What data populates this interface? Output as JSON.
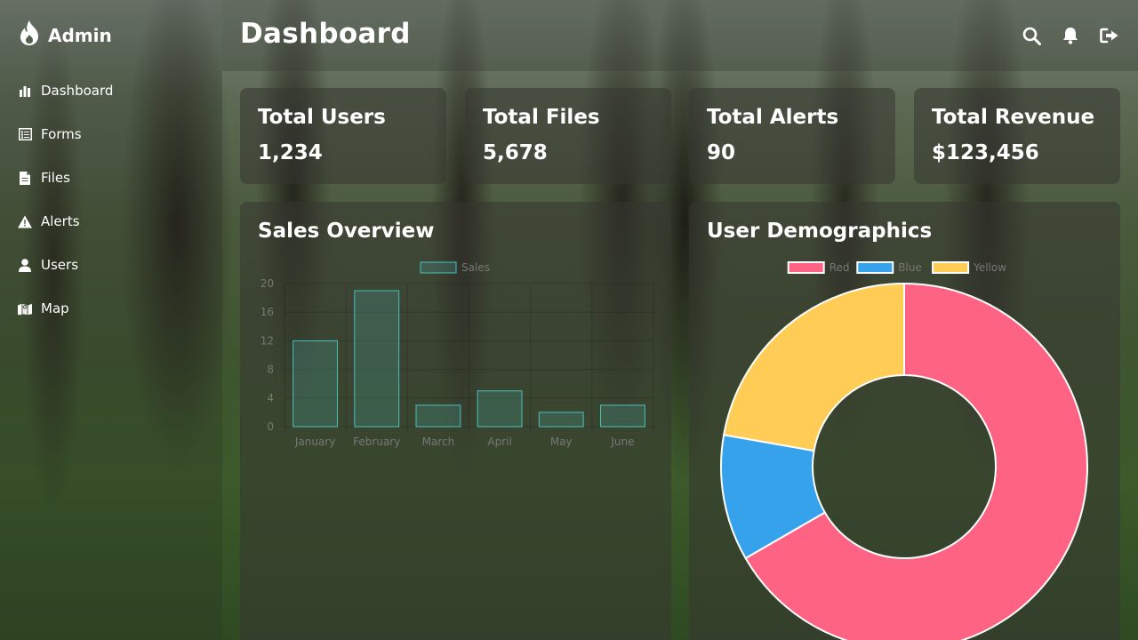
{
  "brand": {
    "name": "Admin",
    "icon": "fire-icon"
  },
  "sidebar": {
    "items": [
      {
        "label": "Dashboard",
        "icon": "bar-chart-icon"
      },
      {
        "label": "Forms",
        "icon": "form-icon"
      },
      {
        "label": "Files",
        "icon": "file-icon"
      },
      {
        "label": "Alerts",
        "icon": "warning-icon"
      },
      {
        "label": "Users",
        "icon": "user-icon"
      },
      {
        "label": "Map",
        "icon": "map-icon"
      }
    ]
  },
  "header": {
    "title": "Dashboard",
    "icons": [
      "search-icon",
      "bell-icon",
      "logout-icon"
    ]
  },
  "stats": [
    {
      "title": "Total Users",
      "value": "1,234"
    },
    {
      "title": "Total Files",
      "value": "5,678"
    },
    {
      "title": "Total Alerts",
      "value": "90"
    },
    {
      "title": "Total Revenue",
      "value": "$123,456"
    }
  ],
  "sales_panel": {
    "title": "Sales Overview"
  },
  "demographics_panel": {
    "title": "User Demographics"
  },
  "chart_data": [
    {
      "type": "bar",
      "title": "",
      "categories": [
        "January",
        "February",
        "March",
        "April",
        "May",
        "June"
      ],
      "series": [
        {
          "name": "Sales",
          "values": [
            12,
            19,
            3,
            5,
            2,
            3
          ]
        }
      ],
      "ylim": [
        0,
        20
      ],
      "yticks": [
        0,
        4,
        8,
        12,
        16,
        20
      ],
      "legend": "top",
      "grid": true,
      "colors": {
        "fill": "#4bc0c0",
        "border": "#4bc0c0"
      }
    },
    {
      "type": "pie",
      "variant": "doughnut",
      "title": "",
      "labels": [
        "Red",
        "Blue",
        "Yellow"
      ],
      "values": [
        300,
        50,
        100
      ],
      "colors": [
        "#ff6384",
        "#36a2eb",
        "#ffcd56"
      ],
      "legend": "top"
    }
  ]
}
